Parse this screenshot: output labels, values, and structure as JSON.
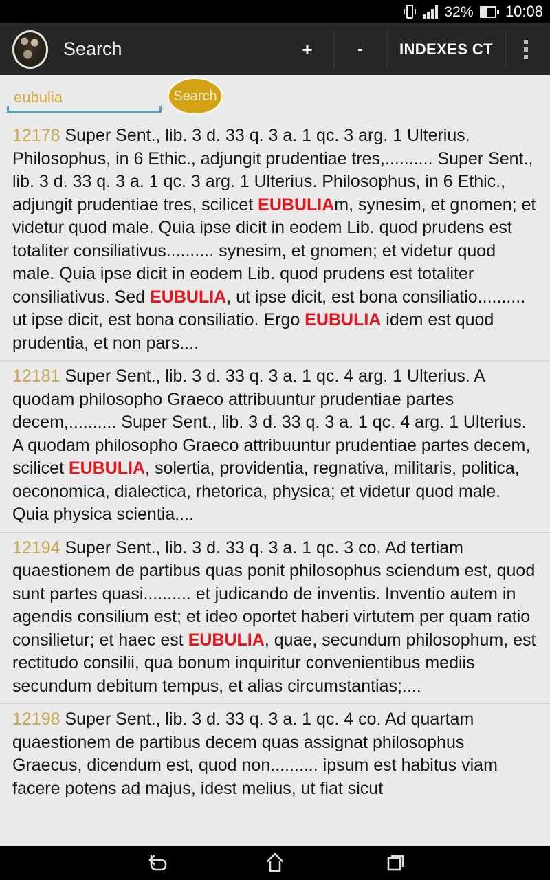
{
  "status_bar": {
    "battery_percent": "32%",
    "time": "10:08",
    "icons": [
      "vibrate-icon",
      "signal-bars-icon",
      "battery-icon"
    ]
  },
  "toolbar": {
    "avatar": "user-avatar",
    "title": "Search",
    "plus_label": "+",
    "minus_label": "-",
    "indexes_label": "INDEXES CT",
    "overflow_label": "overflow-menu"
  },
  "search": {
    "value": "eubulia",
    "placeholder": "eubulia",
    "button_label": "Search",
    "underline_color": "#4aa5b5",
    "text_color": "#d4ab3a",
    "button_color": "#d2a314"
  },
  "colors": {
    "result_number": "#c9a94e",
    "highlight": "#e8141b",
    "background": "#eaeaea",
    "toolbar": "#262626"
  },
  "results": [
    {
      "number": "12178",
      "parts": [
        {
          "t": " Super Sent., lib. 3 d. 33 q. 3 a. 1 qc. 3 arg. 1 Ulterius. Philosophus, in 6 Ethic., adjungit prudentiae tres,.......... Super Sent., lib. 3 d. 33 q. 3 a. 1 qc. 3 arg. 1 Ulterius. Philosophus, in 6 Ethic., adjungit prudentiae tres, scilicet ",
          "h": false
        },
        {
          "t": "EUBULIA",
          "h": true
        },
        {
          "t": "m, synesim, et gnomen; et videtur quod male. Quia ipse dicit in eodem Lib. quod prudens est totaliter consiliativus.......... synesim, et gnomen; et videtur quod male. Quia ipse dicit in eodem Lib. quod prudens est totaliter consiliativus. Sed ",
          "h": false
        },
        {
          "t": "EUBULIA",
          "h": true
        },
        {
          "t": ", ut ipse dicit, est bona consiliatio.......... ut ipse dicit, est bona consiliatio. Ergo ",
          "h": false
        },
        {
          "t": "EUBULIA",
          "h": true
        },
        {
          "t": " idem est quod prudentia, et non pars....",
          "h": false
        }
      ]
    },
    {
      "number": "12181",
      "parts": [
        {
          "t": " Super Sent., lib. 3 d. 33 q. 3 a. 1 qc. 4 arg. 1 Ulterius. A quodam philosopho Graeco attribuuntur prudentiae partes decem,.......... Super Sent., lib. 3 d. 33 q. 3 a. 1 qc. 4 arg. 1 Ulterius. A quodam philosopho Graeco attribuuntur prudentiae partes decem, scilicet ",
          "h": false
        },
        {
          "t": "EUBULIA",
          "h": true
        },
        {
          "t": ", solertia, providentia, regnativa, militaris, politica, oeconomica, dialectica, rhetorica, physica; et videtur quod male. Quia physica scientia....",
          "h": false
        }
      ]
    },
    {
      "number": "12194",
      "parts": [
        {
          "t": " Super Sent., lib. 3 d. 33 q. 3 a. 1 qc. 3 co. Ad tertiam quaestionem de partibus quas ponit philosophus sciendum est, quod sunt partes quasi.......... et judicando de inventis. Inventio autem in agendis consilium est; et ideo oportet haberi virtutem per quam ratio consilietur; et haec est ",
          "h": false
        },
        {
          "t": "EUBULIA",
          "h": true
        },
        {
          "t": ", quae, secundum philosophum, est rectitudo consilii, qua bonum inquiritur convenientibus mediis secundum debitum tempus, et alias circumstantias;....",
          "h": false
        }
      ]
    },
    {
      "number": "12198",
      "parts": [
        {
          "t": " Super Sent., lib. 3 d. 33 q. 3 a. 1 qc. 4 co. Ad quartam quaestionem de partibus decem quas assignat philosophus Graecus, dicendum est, quod non.......... ipsum est habitus viam facere potens ad majus, idest melius, ut fiat sicut",
          "h": false
        }
      ]
    }
  ],
  "nav_bar": {
    "back": "back-icon",
    "home": "home-icon",
    "recents": "recents-icon"
  }
}
